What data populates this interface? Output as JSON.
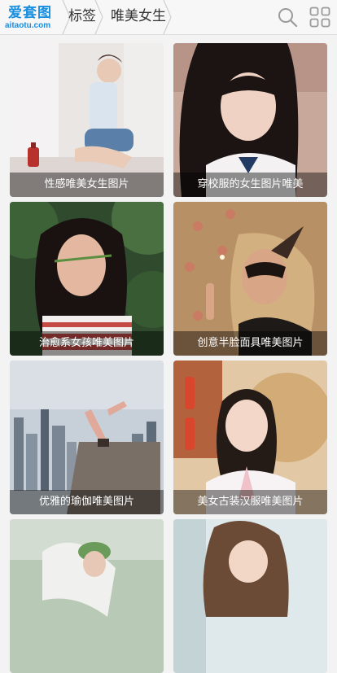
{
  "header": {
    "logo_cn": "爱套图",
    "logo_en": "aitaotu.com",
    "breadcrumbs": [
      "标签",
      "唯美女生"
    ],
    "icons": [
      "search-icon",
      "grid-menu-icon"
    ]
  },
  "gallery": {
    "items": [
      {
        "caption": "性感唯美女生图片"
      },
      {
        "caption": "穿校服的女生图片唯美"
      },
      {
        "caption": "治愈系女孩唯美图片"
      },
      {
        "caption": "创意半脸面具唯美图片"
      },
      {
        "caption": "优雅的瑜伽唯美图片"
      },
      {
        "caption": "美女古装汉服唯美图片"
      },
      {
        "caption": ""
      },
      {
        "caption": ""
      }
    ]
  },
  "colors": {
    "brand": "#1a8fe0",
    "caption_overlay": "rgba(0,0,0,0.42)"
  }
}
